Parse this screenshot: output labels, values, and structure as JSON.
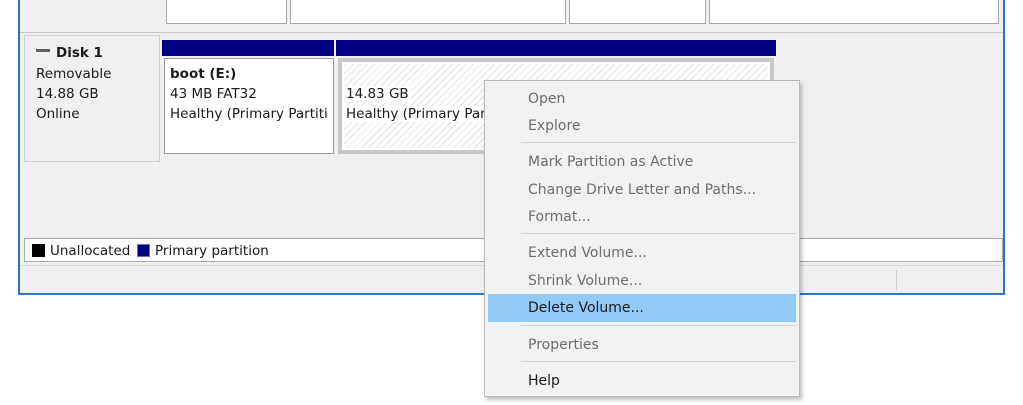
{
  "disk": {
    "name": "Disk 1",
    "type": "Removable",
    "size": "14.88 GB",
    "status": "Online"
  },
  "partitions": [
    {
      "label": "boot  (E:)",
      "detail": "43 MB FAT32",
      "health": "Healthy (Primary Partiti"
    },
    {
      "label": "",
      "detail": "14.83 GB",
      "health": "Healthy (Primary Part"
    }
  ],
  "legend": {
    "items": [
      {
        "label": "Unallocated",
        "color": "#000000"
      },
      {
        "label": "Primary partition",
        "color": "#000080"
      }
    ]
  },
  "context_menu": {
    "items": [
      {
        "label": "Open",
        "enabled": false
      },
      {
        "label": "Explore",
        "enabled": false
      },
      {
        "label": "Mark Partition as Active",
        "enabled": false
      },
      {
        "label": "Change Drive Letter and Paths...",
        "enabled": false
      },
      {
        "label": "Format...",
        "enabled": false
      },
      {
        "label": "Extend Volume...",
        "enabled": false
      },
      {
        "label": "Shrink Volume...",
        "enabled": false
      },
      {
        "label": "Delete Volume...",
        "enabled": true,
        "highlighted": true
      },
      {
        "label": "Properties",
        "enabled": false
      },
      {
        "label": "Help",
        "enabled": true
      }
    ]
  },
  "colors": {
    "primary_partition": "#000080",
    "unallocated": "#000000",
    "menu_highlight": "#91c9f7",
    "window_border": "#2b76c8"
  }
}
